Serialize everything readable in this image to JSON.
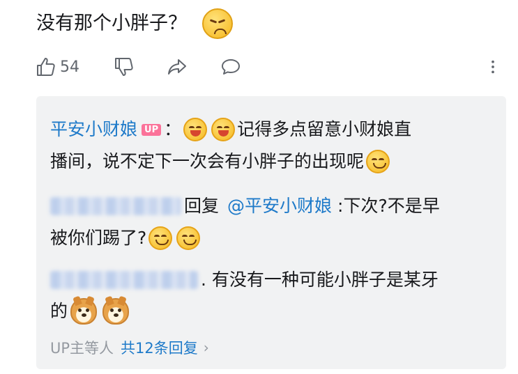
{
  "comment": {
    "text": "没有那个小胖子？",
    "emoji": "annoyed-face-emoji"
  },
  "actions": {
    "like_count": "54",
    "icons": [
      "thumbs-up-icon",
      "thumbs-down-icon",
      "share-icon",
      "reply-bubble-icon",
      "more-vertical-icon"
    ]
  },
  "replies": [
    {
      "author": "平安小财娘",
      "badge": "UP",
      "sep": "：",
      "line1": "记得多点留意小财娘直",
      "line2": "播间，说不定下一次会有小胖子的出现呢"
    },
    {
      "reply_word": "回复",
      "mention": "@平安小财娘",
      "line1": ":下次?不是早",
      "line2": "被你们踢了?"
    },
    {
      "line1": ". 有没有一种可能小胖子是某牙",
      "line2": "的"
    }
  ],
  "more_replies": {
    "prefix": "UP主等人",
    "link": "共12条回复"
  },
  "colors": {
    "link_blue": "#1e7ac9",
    "up_badge_pink": "#fb7299",
    "reply_bg": "#f1f2f3"
  }
}
